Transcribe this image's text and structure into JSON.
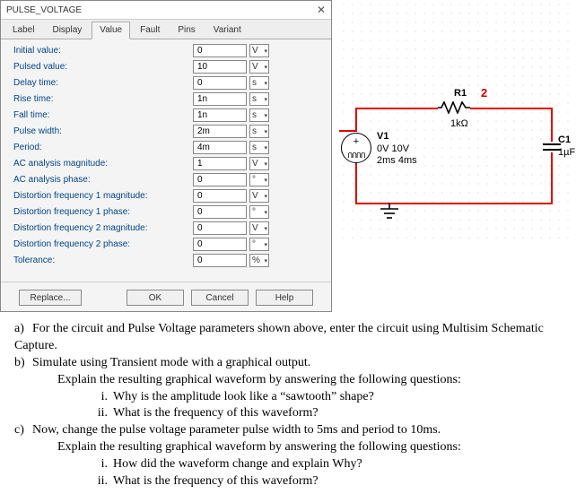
{
  "dialog": {
    "title": "PULSE_VOLTAGE",
    "tabs": [
      "Label",
      "Display",
      "Value",
      "Fault",
      "Pins",
      "Variant"
    ],
    "active_tab": "Value",
    "rows": [
      {
        "label": "Initial value:",
        "value": "0",
        "unit": "V"
      },
      {
        "label": "Pulsed value:",
        "value": "10",
        "unit": "V"
      },
      {
        "label": "Delay time:",
        "value": "0",
        "unit": "s"
      },
      {
        "label": "Rise time:",
        "value": "1n",
        "unit": "s"
      },
      {
        "label": "Fall time:",
        "value": "1n",
        "unit": "s"
      },
      {
        "label": "Pulse width:",
        "value": "2m",
        "unit": "s"
      },
      {
        "label": "Period:",
        "value": "4m",
        "unit": "s"
      },
      {
        "label": "AC analysis magnitude:",
        "value": "1",
        "unit": "V"
      },
      {
        "label": "AC analysis phase:",
        "value": "0",
        "unit": "°"
      },
      {
        "label": "Distortion frequency 1 magnitude:",
        "value": "0",
        "unit": "V"
      },
      {
        "label": "Distortion frequency 1 phase:",
        "value": "0",
        "unit": "°"
      },
      {
        "label": "Distortion frequency 2 magnitude:",
        "value": "0",
        "unit": "V"
      },
      {
        "label": "Distortion frequency 2 phase:",
        "value": "0",
        "unit": "°"
      },
      {
        "label": "Tolerance:",
        "value": "0",
        "unit": "%"
      }
    ],
    "buttons": {
      "replace": "Replace...",
      "ok": "OK",
      "cancel": "Cancel",
      "help": "Help"
    }
  },
  "circuit": {
    "r1": {
      "name": "R1",
      "value": "1kΩ"
    },
    "c1": {
      "name": "C1",
      "value": "1µF"
    },
    "v1": {
      "name": "V1",
      "line1": "0V 10V",
      "line2": "2ms 4ms"
    },
    "node2": "2",
    "src_pulse": "ՈՈՈՈ",
    "src_plus": "+"
  },
  "questions": {
    "a": "For the circuit and Pulse Voltage parameters shown above, enter the circuit using Multisim Schematic Capture.",
    "b": "Simulate using Transient mode with a graphical output.",
    "b_expl": "Explain the resulting graphical waveform by answering the following questions:",
    "b_i": "Why is the amplitude look like a “sawtooth” shape?",
    "b_ii": "What is the frequency of this waveform?",
    "c": "Now, change the pulse voltage parameter pulse width to 5ms and period to 10ms.",
    "c_expl": "Explain the resulting graphical waveform by answering the following questions:",
    "c_i": "How did the waveform change and explain Why?",
    "c_ii": "What is the frequency of this waveform?",
    "li": {
      "a": "a)",
      "b": "b)",
      "c": "c)",
      "i": "i.",
      "ii": "ii."
    }
  }
}
